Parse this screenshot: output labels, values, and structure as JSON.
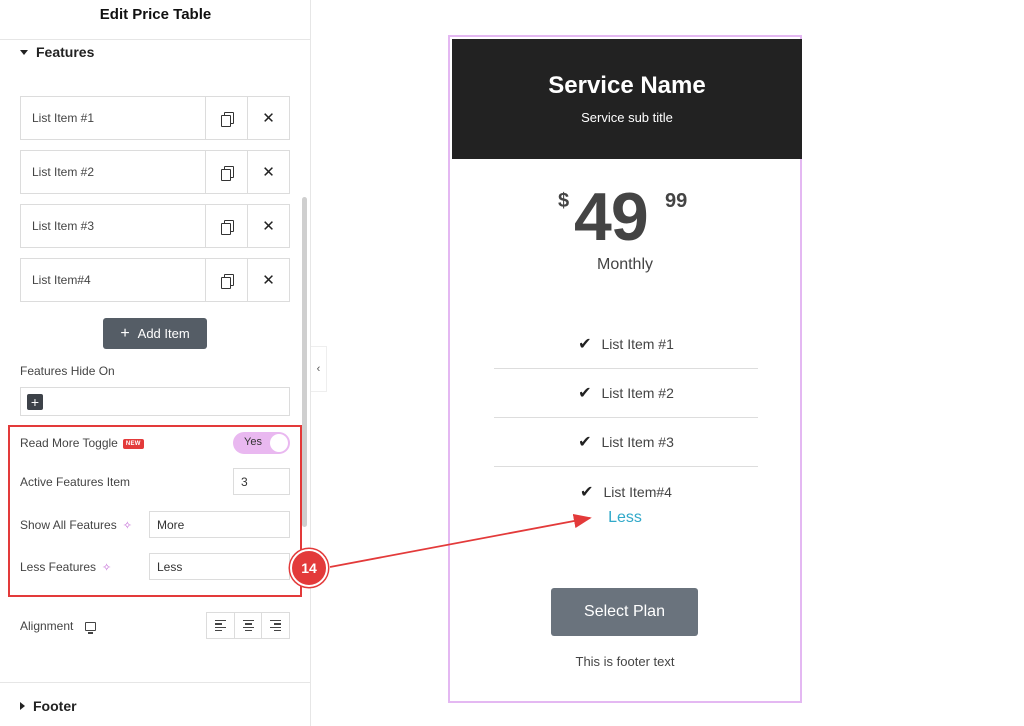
{
  "panel": {
    "title": "Edit Price Table",
    "features_section": "Features",
    "items": [
      {
        "label": "List Item #1"
      },
      {
        "label": "List Item #2"
      },
      {
        "label": "List Item #3"
      },
      {
        "label": "List Item#4"
      }
    ],
    "copy_icon": "duplicate-icon",
    "remove_icon": "close-icon",
    "add_item_label": "Add Item",
    "features_hide_on_label": "Features Hide On",
    "read_more_toggle_label": "Read More Toggle",
    "new_badge": "NEW",
    "toggle_value": "Yes",
    "active_features_label": "Active Features Item",
    "active_features_value": "3",
    "show_all_label": "Show All Features",
    "show_all_value": "More",
    "less_features_label": "Less Features",
    "less_features_value": "Less",
    "alignment_label": "Alignment",
    "footer_section": "Footer"
  },
  "card": {
    "service_name": "Service Name",
    "service_subtitle": "Service sub title",
    "currency": "$",
    "price": "49",
    "cents": "99",
    "period": "Monthly",
    "features": [
      "List Item #1",
      "List Item #2",
      "List Item #3",
      "List Item#4"
    ],
    "less_link": "Less",
    "button_label": "Select Plan",
    "footer_text": "This is footer text"
  },
  "annotation": {
    "step_number": "14"
  },
  "colors": {
    "highlight": "#e33a3a",
    "header_bg": "#222222",
    "card_border": "#e4b8f2",
    "link": "#31a9c9",
    "button": "#6a737d",
    "toggle_on": "#e9b8f0"
  }
}
